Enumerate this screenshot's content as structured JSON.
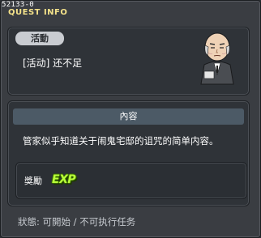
{
  "window": {
    "id_text": "52133-0",
    "title": "QUEST INFO"
  },
  "quest": {
    "category_label": "活動",
    "name": "[活动] 还不足"
  },
  "content": {
    "header": "內容",
    "description": "管家似乎知道关于闹鬼宅邸的诅咒的简单内容。"
  },
  "reward": {
    "label": "獎勵",
    "exp_badge": "EXP"
  },
  "status": {
    "text": "狀態: 可開始 / 不可执行任务"
  },
  "colors": {
    "title": "#f4e28a",
    "exp": "#b9ff3a",
    "panel": "#2f3338",
    "header_bar": "#4c5a66"
  },
  "icons": {
    "npc": "butler-npc-portrait",
    "exp": "exp-icon"
  }
}
